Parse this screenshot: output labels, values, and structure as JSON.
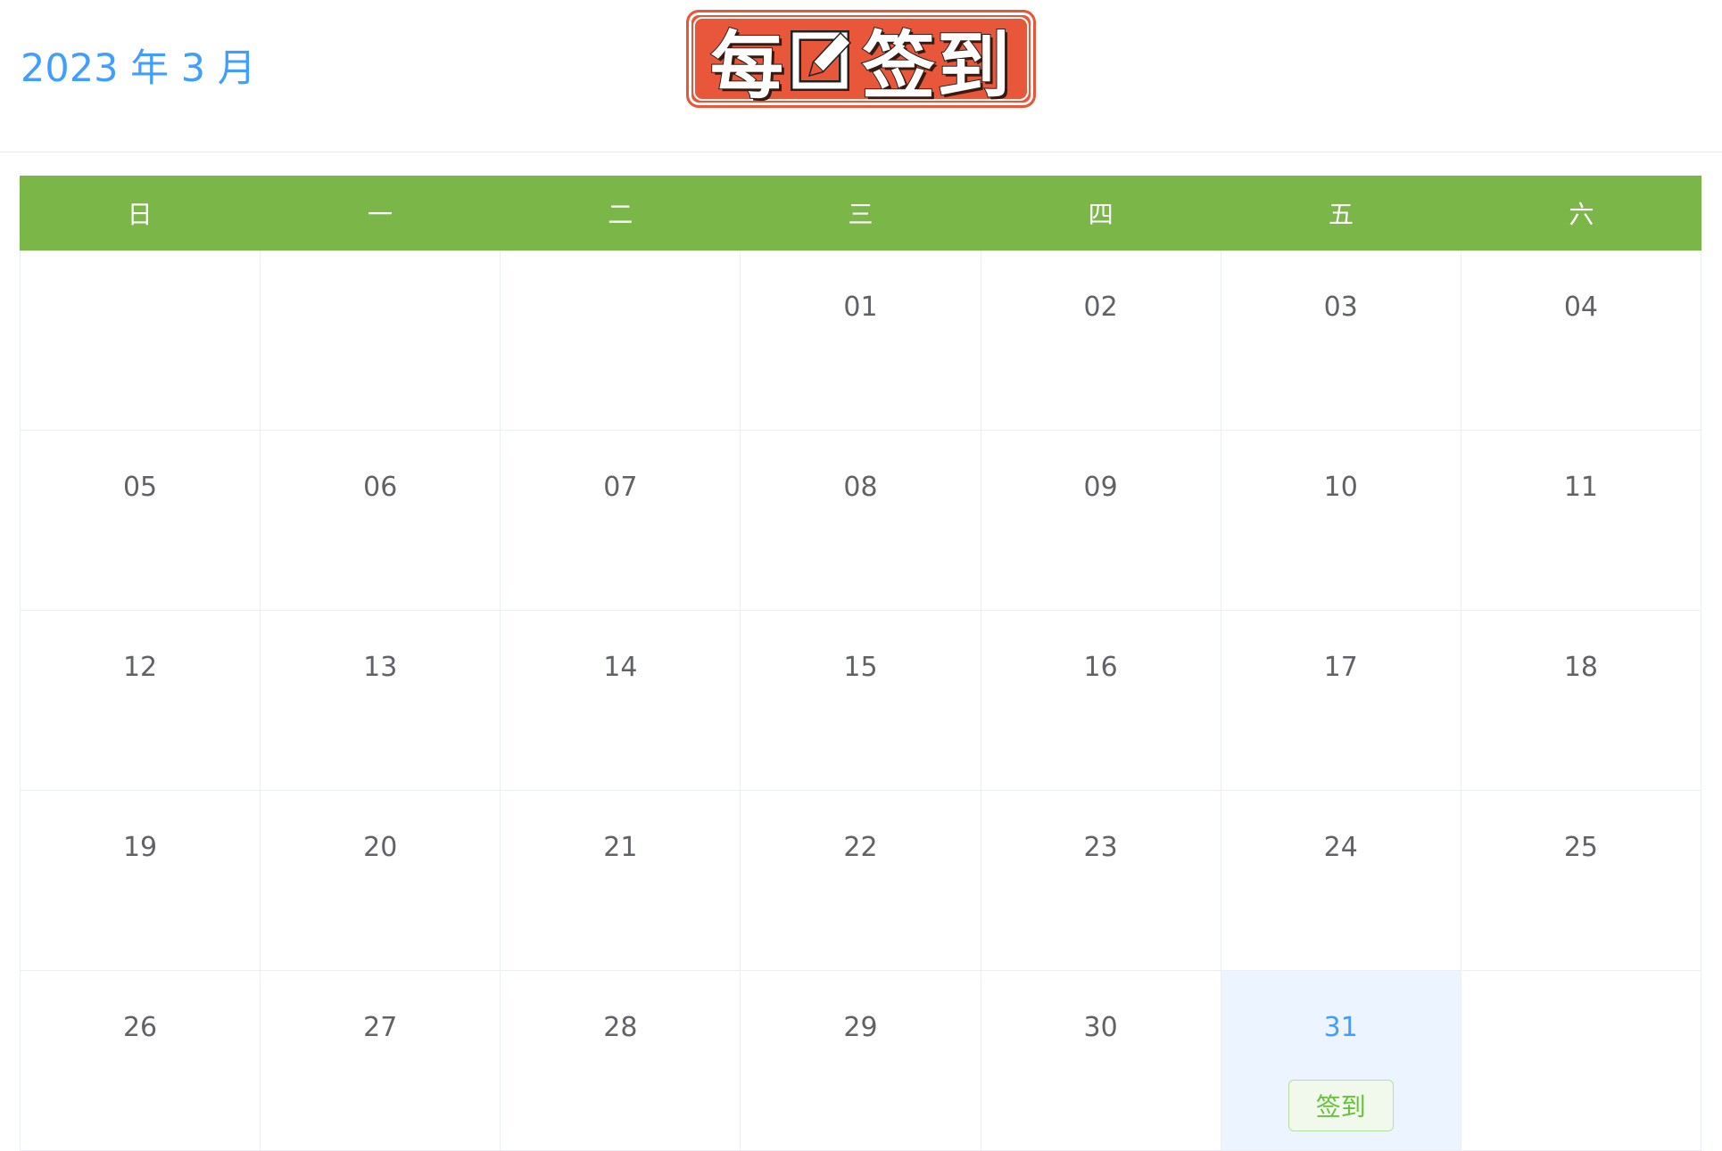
{
  "header": {
    "month_title": "2023 年 3 月",
    "logo_text_left": "每",
    "logo_text_right": "签到",
    "logo_alt": "每日签到"
  },
  "calendar": {
    "weekdays": [
      "日",
      "一",
      "二",
      "三",
      "四",
      "五",
      "六"
    ],
    "weeks": [
      [
        "",
        "",
        "",
        "01",
        "02",
        "03",
        "04"
      ],
      [
        "05",
        "06",
        "07",
        "08",
        "09",
        "10",
        "11"
      ],
      [
        "12",
        "13",
        "14",
        "15",
        "16",
        "17",
        "18"
      ],
      [
        "19",
        "20",
        "21",
        "22",
        "23",
        "24",
        "25"
      ],
      [
        "26",
        "27",
        "28",
        "29",
        "30",
        "31",
        ""
      ]
    ],
    "today": "31",
    "sign_label": "签到"
  },
  "colors": {
    "accent_blue": "#409eff",
    "header_green": "#7ab648",
    "logo_orange": "#e8573a",
    "sign_green": "#67c23a",
    "today_bg": "#ecf5ff"
  },
  "icons": {
    "logo_pen": "pen-in-box-icon"
  }
}
